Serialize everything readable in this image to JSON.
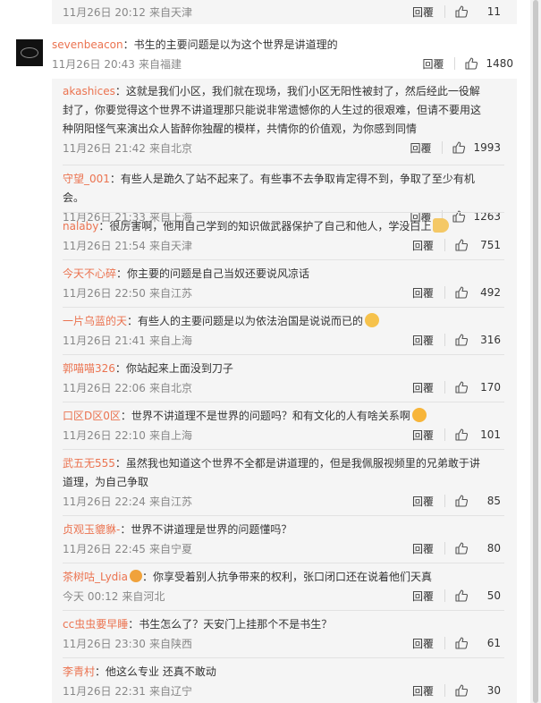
{
  "top_partial": {
    "time": "11月26日 20:12",
    "place": "来自天津",
    "reply_label": "回覆",
    "likes": "11"
  },
  "main": {
    "author": "sevenbeacon",
    "sep": "：",
    "text": "书生的主要问题是以为这个世界是讲道理的",
    "time": "11月26日 20:43",
    "place": "来自福建",
    "reply_label": "回覆",
    "likes": "1480"
  },
  "replies": [
    {
      "author": "akashices",
      "sep": "：",
      "text": "这就是我们小区，我们就在现场，我们小区无阳性被封了，然后经此一役解封了，你要觉得这个世界不讲道理那只能说非常遗憾你的人生过的很艰难，但请不要用这种阴阳怪气来演出众人皆醉你独醒的模样，共情你的价值观，为你感到同情",
      "time": "11月26日 21:42",
      "place": "来自北京",
      "reply_label": "回覆",
      "likes": "1993"
    },
    {
      "author": "守望_001",
      "sep": "：",
      "text": "有些人是跪久了站不起来了。有些事不去争取肯定得不到，争取了至少有机会。",
      "time": "11月26日 21:33",
      "place": "来自上海",
      "reply_label": "回覆",
      "likes": "1263"
    },
    {
      "author": "nalaby",
      "sep": "：",
      "text": "很厉害啊，他用自己学到的知识做武器保护了自己和他人，学没白上",
      "time": "11月26日 21:54",
      "place": "来自天津",
      "reply_label": "回覆",
      "likes": "751",
      "emoji": "thumbs-up-emoji"
    },
    {
      "author": "今天不心碎",
      "sep": "：",
      "text": "你主要的问题是自己当奴还要说风凉话",
      "time": "11月26日 22:50",
      "place": "来自江苏",
      "reply_label": "回覆",
      "likes": "492"
    },
    {
      "author": "一片乌蓝的天",
      "sep": "：",
      "text": "有些人的主要问题是以为依法治国是说说而已的",
      "time": "11月26日 21:41",
      "place": "来自上海",
      "reply_label": "回覆",
      "likes": "316",
      "emoji": "face-emoji"
    },
    {
      "author": "郭喵喵326",
      "sep": "：",
      "text": "你站起来上面没到刀子",
      "time": "11月26日 22:06",
      "place": "来自北京",
      "reply_label": "回覆",
      "likes": "170"
    },
    {
      "author": "口区D区0区",
      "sep": "：",
      "text": "世界不讲道理不是世界的问题吗？和有文化的人有啥关系啊",
      "time": "11月26日 22:10",
      "place": "来自上海",
      "reply_label": "回覆",
      "likes": "101",
      "emoji": "grin-emoji"
    },
    {
      "author": "武五无555",
      "sep": "：",
      "text": "虽然我也知道这个世界不全都是讲道理的，但是我佩服视频里的兄弟敢于讲道理，为自己争取",
      "time": "11月26日 22:24",
      "place": "来自江苏",
      "reply_label": "回覆",
      "likes": "85"
    },
    {
      "author": "贞观玉貔貅-",
      "sep": "：",
      "text": "世界不讲道理是世界的问题懂吗？",
      "time": "11月26日 22:45",
      "place": "来自宁夏",
      "reply_label": "回覆",
      "likes": "80"
    },
    {
      "author": "茶树咕_Lydia",
      "sep": "：",
      "text": "你享受着别人抗争带来的权利，张口闭口还在说着他们天真",
      "time": "今天 00:12",
      "place": "来自河北",
      "reply_label": "回覆",
      "likes": "50",
      "badge": "member-badge-icon"
    },
    {
      "author": "cc虫虫要早睡",
      "sep": "：",
      "text": "书生怎么了？天安门上挂那个不是书生？",
      "time": "11月26日 23:30",
      "place": "来自陕西",
      "reply_label": "回覆",
      "likes": "61"
    },
    {
      "author": "李青村",
      "sep": "：",
      "text": "他这么专业 还真不敢动",
      "time": "11月26日 22:31",
      "place": "来自辽宁",
      "reply_label": "回覆",
      "likes": "30"
    }
  ]
}
